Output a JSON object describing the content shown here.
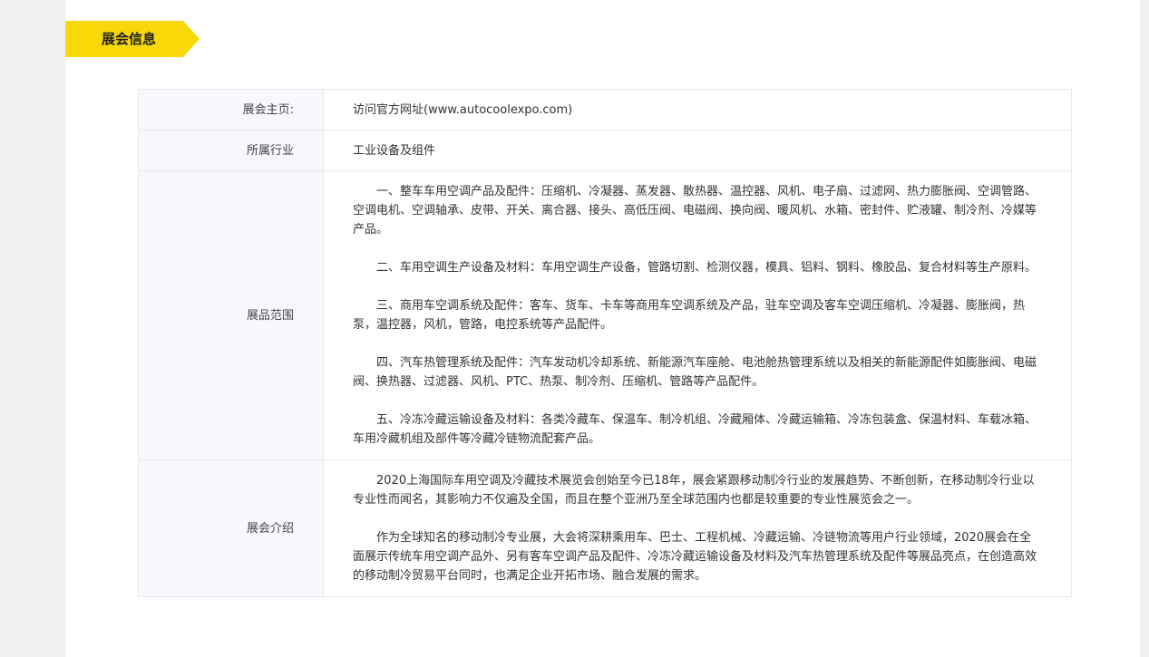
{
  "section": {
    "title": "展会信息",
    "accent_color": "#f8d808"
  },
  "info": {
    "homepage": {
      "label": "展会主页:",
      "value": "访问官方网址(www.autocoolexpo.com)"
    },
    "industry": {
      "label": "所属行业",
      "value": "工业设备及组件"
    },
    "scope": {
      "label": "展品范围",
      "paragraphs": [
        "一、整车车用空调产品及配件：压缩机、冷凝器、蒸发器、散热器、温控器、风机、电子扇、过滤网、热力膨胀阀、空调管路、空调电机、空调轴承、皮带、开关、离合器、接头、高低压阀、电磁阀、换向阀、暖风机、水箱、密封件、贮液罐、制冷剂、冷媒等产品。",
        "二、车用空调生产设备及材料：车用空调生产设备，管路切割、检测仪器，模具、铝料、钢料、橡胶品、复合材料等生产原料。",
        "三、商用车空调系统及配件：客车、货车、卡车等商用车空调系统及产品，驻车空调及客车空调压缩机、冷凝器、膨胀阀，热泵，温控器，风机，管路，电控系统等产品配件。",
        "四、汽车热管理系统及配件：汽车发动机冷却系统、新能源汽车座舱、电池舱热管理系统以及相关的新能源配件如膨胀阀、电磁阀、换热器、过滤器、风机、PTC、热泵、制冷剂、压缩机、管路等产品配件。",
        "五、冷冻冷藏运输设备及材料：各类冷藏车、保温车、制冷机组、冷藏厢体、冷藏运输箱、冷冻包装盒、保温材料、车载冰箱、车用冷藏机组及部件等冷藏冷链物流配套产品。"
      ]
    },
    "intro": {
      "label": "展会介绍",
      "paragraphs": [
        "2020上海国际车用空调及冷藏技术展览会创始至今已18年，展会紧跟移动制冷行业的发展趋势、不断创新，在移动制冷行业以专业性而闻名，其影响力不仅遍及全国，而且在整个亚洲乃至全球范围内也都是较重要的专业性展览会之一。",
        "作为全球知名的移动制冷专业展，大会将深耕乘用车、巴士、工程机械、冷藏运输、冷链物流等用户行业领域，2020展会在全面展示传统车用空调产品外、另有客车空调产品及配件、冷冻冷藏运输设备及材料及汽车热管理系统及配件等展品亮点，在创造高效的移动制冷贸易平台同时，也满足企业开拓市场、融合发展的需求。"
      ]
    }
  }
}
